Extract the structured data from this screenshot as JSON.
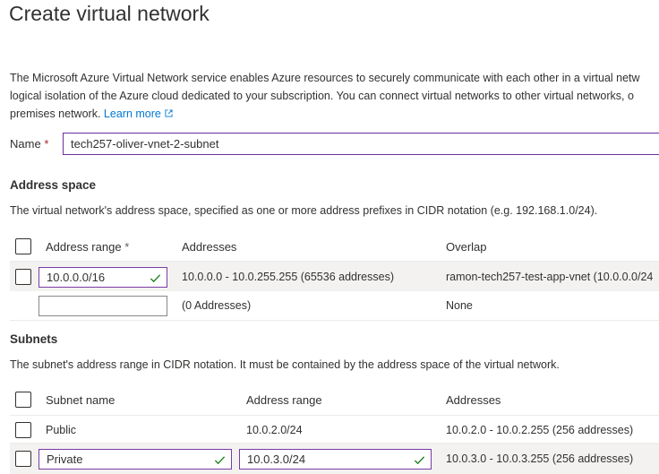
{
  "page": {
    "title": "Create virtual network"
  },
  "description": {
    "line1": "The Microsoft Azure Virtual Network service enables Azure resources to securely communicate with each other in a virtual netw",
    "line2": "logical isolation of the Azure cloud dedicated to your subscription. You can connect virtual networks to other virtual networks, o",
    "line3_prefix": "premises network.",
    "learn_more": "Learn more"
  },
  "name_field": {
    "label": "Name",
    "required_mark": "*",
    "value": "tech257-oliver-vnet-2-subnet"
  },
  "address_space": {
    "heading": "Address space",
    "description": "The virtual network's address space, specified as one or more address prefixes in CIDR notation (e.g. 192.168.1.0/24).",
    "columns": {
      "range": "Address range",
      "required_mark": "*",
      "addresses": "Addresses",
      "overlap": "Overlap"
    },
    "rows": [
      {
        "range": "10.0.0.0/16",
        "addresses": "10.0.0.0 - 10.0.255.255 (65536 addresses)",
        "overlap": "ramon-tech257-test-app-vnet (10.0.0.0/24"
      },
      {
        "range": "",
        "addresses": "(0 Addresses)",
        "overlap": "None"
      }
    ]
  },
  "subnets": {
    "heading": "Subnets",
    "description": "The subnet's address range in CIDR notation. It must be contained by the address space of the virtual network.",
    "columns": {
      "name": "Subnet name",
      "range": "Address range",
      "addresses": "Addresses"
    },
    "rows": [
      {
        "name": "Public",
        "range": "10.0.2.0/24",
        "addresses": "10.0.2.0 - 10.0.2.255 (256 addresses)"
      },
      {
        "name": "Private",
        "range": "10.0.3.0/24",
        "addresses": "10.0.3.0 - 10.0.3.255 (256 addresses)"
      }
    ]
  },
  "colors": {
    "accent_link": "#0078d4",
    "valid_check": "#107c10",
    "input_focus_border": "#6b2fa0",
    "selected_row": "#f3f2f1"
  }
}
